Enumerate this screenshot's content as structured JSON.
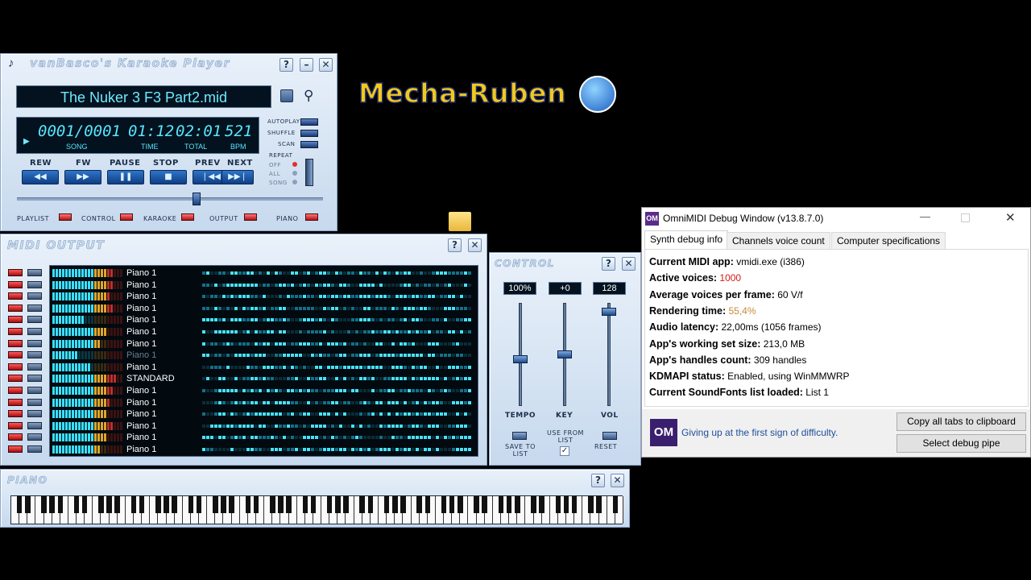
{
  "player": {
    "title": "vanBasco's Karaoke Player",
    "song_name": "The Nuker 3 F3 Part2.mid",
    "song_counter": "0001/0001",
    "time": "01:12",
    "total": "02:01",
    "bpm": "521",
    "lcd_labels": {
      "song": "SONG",
      "time": "TIME",
      "total": "TOTAL",
      "bpm": "BPM"
    },
    "options": {
      "autoplay": "AUTOPLAY",
      "shuffle": "SHUFFLE",
      "scan": "SCAN",
      "repeat": "REPEAT",
      "off": "OFF",
      "all": "ALL",
      "song": "SONG"
    },
    "transport_labels": [
      "REW",
      "FW",
      "PAUSE",
      "STOP",
      "PREV",
      "NEXT"
    ],
    "transport_glyphs": [
      "◀◀",
      "▶▶",
      "❚❚",
      "■",
      "❘◀◀",
      "▶▶❘"
    ],
    "progress": 0.59,
    "toggles": [
      "PLAYLIST",
      "CONTROL",
      "KARAOKE",
      "OUTPUT",
      "PIANO"
    ],
    "win_buttons": {
      "help": "?",
      "minimize": "–",
      "close": "✕"
    }
  },
  "logo": {
    "text": "Mecha-Ruben"
  },
  "midi_output": {
    "title": "MIDI OUTPUT",
    "channels": [
      {
        "name": "Piano 1",
        "level": 0.85,
        "active": true
      },
      {
        "name": "Piano 1",
        "level": 0.85,
        "active": true
      },
      {
        "name": "Piano 1",
        "level": 0.8,
        "active": true
      },
      {
        "name": "Piano 1",
        "level": 0.85,
        "active": true
      },
      {
        "name": "Piano 1",
        "level": 0.45,
        "active": true
      },
      {
        "name": "Piano 1",
        "level": 0.75,
        "active": true
      },
      {
        "name": "Piano 1",
        "level": 0.7,
        "active": true
      },
      {
        "name": "Piano 1",
        "level": 0.35,
        "active": false
      },
      {
        "name": "Piano 1",
        "level": 0.55,
        "active": true
      },
      {
        "name": "STANDARD",
        "level": 0.9,
        "active": true
      },
      {
        "name": "Piano 1",
        "level": 0.85,
        "active": true
      },
      {
        "name": "Piano 1",
        "level": 0.8,
        "active": true
      },
      {
        "name": "Piano 1",
        "level": 0.75,
        "active": true
      },
      {
        "name": "Piano 1",
        "level": 0.85,
        "active": true
      },
      {
        "name": "Piano 1",
        "level": 0.75,
        "active": true
      },
      {
        "name": "Piano 1",
        "level": 0.7,
        "active": true
      }
    ]
  },
  "control": {
    "title": "CONTROL",
    "tempo_value": "100%",
    "key_value": "+0",
    "vol_value": "128",
    "tempo_level": 0.45,
    "key_level": 0.5,
    "vol_level": 0.95,
    "labels": {
      "tempo": "TEMPO",
      "key": "KEY",
      "vol": "VOL"
    },
    "save_to_list": "SAVE TO LIST",
    "use_from_list": "USE FROM LIST",
    "reset": "RESET",
    "use_from_list_checked": true
  },
  "piano": {
    "title": "PIANO"
  },
  "omnimidi": {
    "window_title": "OmniMIDI Debug Window (v13.8.7.0)",
    "app_icon_text": "OM",
    "tabs": [
      "Synth debug info",
      "Channels voice count",
      "Computer specifications"
    ],
    "rows": [
      {
        "label": "Current MIDI app:",
        "value": "vmidi.exe (i386)",
        "color": "#000000"
      },
      {
        "label": "Active voices:",
        "value": "1000",
        "color": "#d11a1a"
      },
      {
        "label": "Average voices per frame:",
        "value": "60 V/f",
        "color": "#000000"
      },
      {
        "label": "Rendering time:",
        "value": "55,4%",
        "color": "#c88a3a"
      },
      {
        "label": "Audio latency:",
        "value": "22,00ms (1056 frames)",
        "color": "#000000"
      },
      {
        "label": "App's working set size:",
        "value": "213,0 MB",
        "color": "#000000"
      },
      {
        "label": "App's handles count:",
        "value": "309 handles",
        "color": "#000000"
      },
      {
        "label": "KDMAPI status:",
        "value": "Enabled, using WinMMWRP",
        "color": "#000000"
      },
      {
        "label": "Current SoundFonts list loaded:",
        "value": "List 1",
        "color": "#000000"
      }
    ],
    "footer_logo": "OM",
    "footer_text": "Giving up at the first sign of difficulty.",
    "copy_button": "Copy all tabs to clipboard",
    "pipe_button": "Select debug pipe"
  }
}
